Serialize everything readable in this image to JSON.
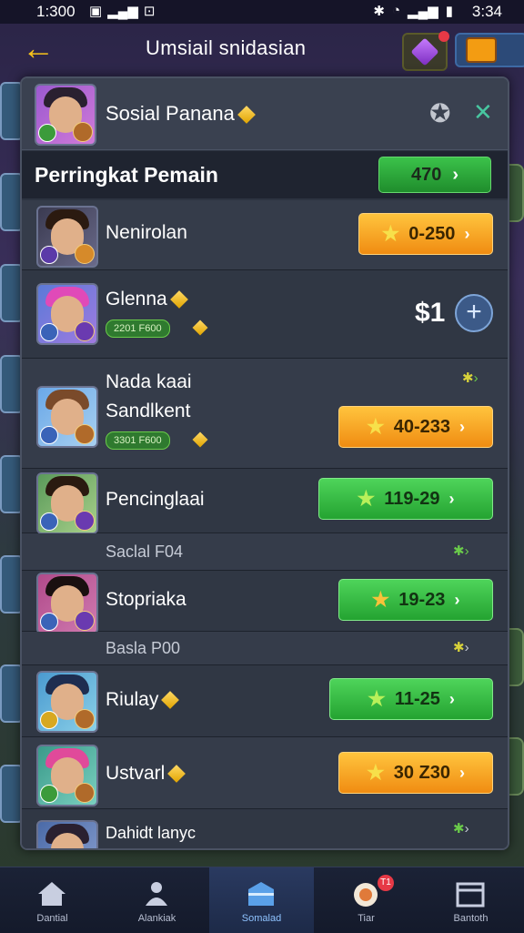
{
  "status_bar": {
    "time_left": "1:300",
    "time_right": "3:34"
  },
  "header": {
    "title": "Umsiail snidasian",
    "back_icon": "back-arrow-icon"
  },
  "panel": {
    "name": "Sosial Panana",
    "section_title": "Perringkat Pemain",
    "section_value": "470"
  },
  "rows": [
    {
      "name": "Nenirolan",
      "score": "0-250"
    },
    {
      "name": "Glenna",
      "badge": "2201 F600",
      "amount": "$1"
    },
    {
      "name_line1": "Nada kaai",
      "name_line2": "Sandlkent",
      "badge": "3301 F600",
      "score": "40-233"
    },
    {
      "name": "Pencinglaai",
      "score": "119-29"
    },
    {
      "sub_label": "Saclal F04"
    },
    {
      "name": "Stopriaka",
      "score": "19-23"
    },
    {
      "sub_label": "Basla P00"
    },
    {
      "name": "Riulay",
      "score": "11-25"
    },
    {
      "name": "Ustvarl",
      "score": "30 Z30"
    },
    {
      "name": "Dahidt lanyc"
    }
  ],
  "bottom_nav": [
    {
      "label": "Dantial",
      "icon": "home-icon"
    },
    {
      "label": "Alankiak",
      "icon": "people-icon"
    },
    {
      "label": "Somalad",
      "icon": "shop-icon"
    },
    {
      "label": "Tiar",
      "icon": "chat-icon",
      "badge": "T1"
    },
    {
      "label": "Bantoth",
      "icon": "calendar-icon"
    }
  ]
}
